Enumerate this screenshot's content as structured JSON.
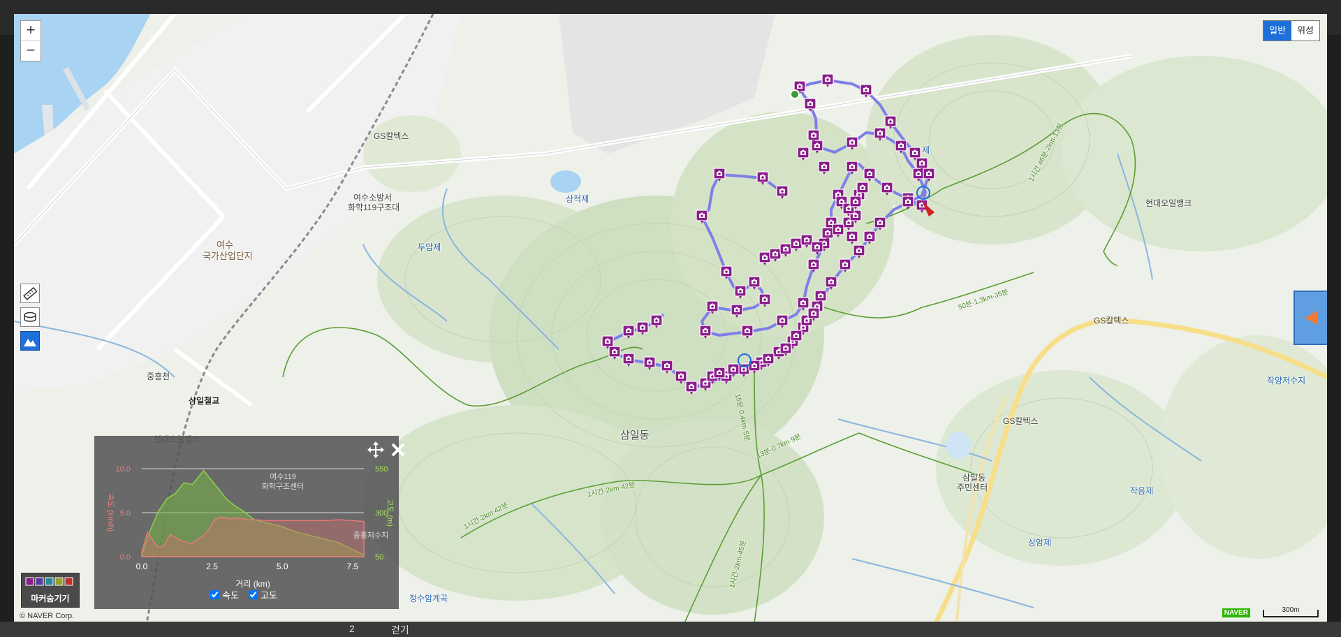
{
  "bottom_bar": {
    "num": "2",
    "walk": "걷기"
  },
  "map": {
    "zoom_in": "+",
    "zoom_out": "−",
    "map_types": [
      {
        "label": "일반",
        "active": true
      },
      {
        "label": "위성",
        "active": false
      }
    ],
    "labels": {
      "gs_caltex_1": "GS칼텍스",
      "fire_station": "여수소방서",
      "rescue_team": "화학119구조대",
      "yeosu": "여수",
      "industrial": "국가산업단지",
      "sangjeokje": "상적제",
      "duamje": "두암제",
      "jeunghungcheon": "중흥천",
      "samil_bridge": "삼일철교",
      "hyundai_oilbank_1": "현대오일뱅크",
      "samil_dong": "삼일동",
      "hyundai_oilbank_2": "현대오일뱅크",
      "gs_caltex_2": "GS칼텍스",
      "gs_caltex_3": "GS칼텍스",
      "jakyang_reservoir": "작양저수지",
      "samil_center_1": "삼일동",
      "samil_center_2": "주민센터",
      "jageumje": "작음제",
      "sanganje": "상암제",
      "jeongsu": "정수암계곡",
      "yeosu119_1": "여수119",
      "yeosu119_2": "화학구조센터",
      "jungheung_reservoir": "중흥저수지",
      "lake_label": "제",
      "trail_1": "1시간 46분·2km·13분",
      "trail_2": "50분·1.3km·35분",
      "trail_3": "1시간·2km·42분",
      "trail_4": "13분·0.7km·9분",
      "trail_5": "1시간·2km·42분",
      "trail_6": "1시간·2km·45분",
      "trail_7": "15분·0.4km·5분"
    },
    "copyright": "© NAVER Corp.",
    "naver_logo": "NAVER",
    "scale": "300m",
    "marker_hide_label": "마커숨기기",
    "accent": "#1e6fd9",
    "route_color": "#7f7fe8",
    "marker_color": "#8b1e8b",
    "trail_color": "#5a9e32"
  },
  "elevation_panel": {
    "speed_checkbox": "속도",
    "altitude_checkbox": "고도",
    "speed_checked": true,
    "altitude_checked": true,
    "chart_data": {
      "type": "area",
      "xlabel": "거리 (km)",
      "ylabel_left": "속도 (km/h)",
      "ylabel_right": "고도 (m)",
      "x_ticks": [
        "0.0",
        "2.5",
        "5.0",
        "7.5"
      ],
      "y_left_ticks": [
        "0.0",
        "5.0",
        "10.0"
      ],
      "y_right_ticks": [
        "50",
        "300",
        "550"
      ],
      "xlim": [
        0,
        7.9
      ],
      "ylim_left": [
        0,
        10
      ],
      "ylim_right": [
        50,
        550
      ],
      "series": [
        {
          "color": "#e87878",
          "x": [
            0,
            0.2,
            0.4,
            0.6,
            0.8,
            1.0,
            1.2,
            1.4,
            1.6,
            1.8,
            2.0,
            2.2,
            2.4,
            2.6,
            2.8,
            3.0,
            3.2,
            3.4,
            3.6,
            3.8,
            4.0,
            4.5,
            5.0,
            5.5,
            6.0,
            6.5,
            7.0,
            7.5,
            7.9
          ],
          "values": [
            0.5,
            2.8,
            1.8,
            1.0,
            1.3,
            2.5,
            2.2,
            1.8,
            1.6,
            1.5,
            2.0,
            2.4,
            3.2,
            4.2,
            4.5,
            4.4,
            4.3,
            4.4,
            4.3,
            4.2,
            4.2,
            4.1,
            4.1,
            4.1,
            4.1,
            4.1,
            4.2,
            4.1,
            4.0
          ]
        },
        {
          "color": "#8fd24a",
          "x": [
            0,
            0.3,
            0.6,
            0.9,
            1.2,
            1.5,
            1.8,
            2.0,
            2.2,
            2.5,
            2.8,
            3.0,
            3.3,
            3.6,
            4.0,
            4.5,
            5.0,
            5.5,
            6.0,
            6.5,
            7.0,
            7.5,
            7.9
          ],
          "values": [
            60,
            200,
            310,
            380,
            410,
            470,
            460,
            500,
            540,
            480,
            420,
            380,
            340,
            310,
            260,
            240,
            220,
            190,
            170,
            150,
            130,
            90,
            60
          ]
        }
      ]
    }
  }
}
